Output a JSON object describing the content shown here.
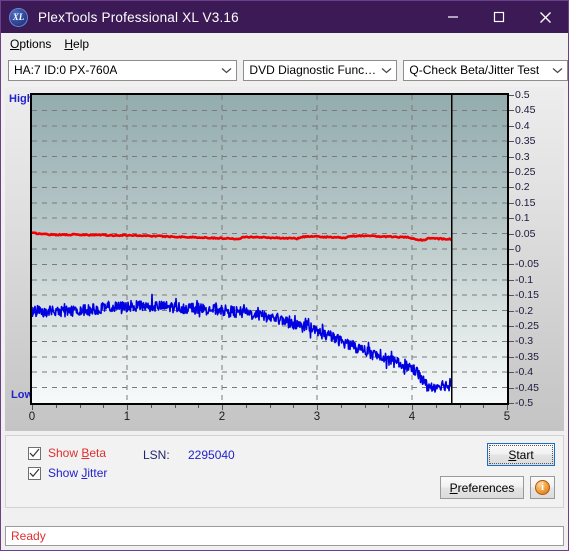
{
  "window": {
    "title": "PlexTools Professional XL V3.16",
    "logo_text": "XL",
    "minimize_icon": "minimize-icon",
    "maximize_icon": "maximize-icon",
    "close_icon": "close-icon"
  },
  "menubar": {
    "items": [
      {
        "label": "Options",
        "mnemonic": "O",
        "rest": "ptions"
      },
      {
        "label": "Help",
        "mnemonic": "H",
        "rest": "elp"
      }
    ]
  },
  "toolbar": {
    "drive_select": {
      "value": "HA:7 ID:0  PX-760A",
      "options": [
        "HA:7 ID:0  PX-760A"
      ]
    },
    "function_select": {
      "value": "DVD Diagnostic Functions",
      "options": [
        "DVD Diagnostic Functions"
      ]
    },
    "test_select": {
      "value": "Q-Check Beta/Jitter Test",
      "options": [
        "Q-Check Beta/Jitter Test"
      ]
    },
    "chevron_icon": "chevron-down-icon"
  },
  "chart_data": {
    "type": "line",
    "title": "Q-Check Beta/Jitter Test",
    "xlabel": "",
    "ylabel": "",
    "left_axis_top_label": "High",
    "left_axis_bottom_label": "Low",
    "xlim": [
      0,
      5
    ],
    "ylim": [
      -0.5,
      0.5
    ],
    "xticks": [
      0,
      1,
      2,
      3,
      4,
      5
    ],
    "xtick_labels": [
      "0",
      "1",
      "2",
      "3",
      "4",
      "5"
    ],
    "yticks": [
      0.5,
      0.45,
      0.4,
      0.35,
      0.3,
      0.25,
      0.2,
      0.15,
      0.1,
      0.05,
      0,
      -0.05,
      -0.1,
      -0.15,
      -0.2,
      -0.25,
      -0.3,
      -0.35,
      -0.4,
      -0.45,
      -0.5
    ],
    "ytick_labels": [
      "0.5",
      "0.45",
      "0.4",
      "0.35",
      "0.3",
      "0.25",
      "0.2",
      "0.15",
      "0.1",
      "0.05",
      "0",
      "-0.05",
      "-0.1",
      "-0.15",
      "-0.2",
      "-0.25",
      "-0.3",
      "-0.35",
      "-0.4",
      "-0.45",
      "-0.5"
    ],
    "grid": true,
    "grid_style": "dashed",
    "grid_color": "#7a7a7a",
    "data_end_x": 4.42,
    "end_marker": true,
    "series": [
      {
        "name": "Beta",
        "color": "#f00000",
        "x": [
          0.0,
          0.1,
          0.2,
          0.3,
          0.4,
          0.5,
          0.6,
          0.7,
          0.8,
          0.9,
          1.0,
          1.1,
          1.2,
          1.3,
          1.4,
          1.5,
          1.6,
          1.7,
          1.8,
          1.9,
          2.0,
          2.1,
          2.18,
          2.22,
          2.3,
          2.4,
          2.5,
          2.6,
          2.7,
          2.8,
          2.86,
          2.92,
          3.0,
          3.1,
          3.2,
          3.3,
          3.38,
          3.44,
          3.55,
          3.65,
          3.75,
          3.85,
          3.95,
          4.05,
          4.12,
          4.18,
          4.25,
          4.32,
          4.42
        ],
        "y": [
          0.052,
          0.049,
          0.047,
          0.046,
          0.047,
          0.046,
          0.045,
          0.046,
          0.045,
          0.044,
          0.045,
          0.044,
          0.043,
          0.042,
          0.041,
          0.04,
          0.039,
          0.038,
          0.037,
          0.036,
          0.035,
          0.034,
          0.033,
          0.04,
          0.039,
          0.038,
          0.037,
          0.036,
          0.035,
          0.034,
          0.04,
          0.041,
          0.04,
          0.039,
          0.038,
          0.037,
          0.042,
          0.043,
          0.042,
          0.041,
          0.04,
          0.039,
          0.038,
          0.03,
          0.029,
          0.035,
          0.034,
          0.033,
          0.032
        ]
      },
      {
        "name": "Jitter",
        "color": "#0000e0",
        "x": [
          0.0,
          0.1,
          0.2,
          0.3,
          0.4,
          0.5,
          0.6,
          0.7,
          0.8,
          0.9,
          1.0,
          1.1,
          1.2,
          1.3,
          1.4,
          1.5,
          1.6,
          1.7,
          1.8,
          1.9,
          2.0,
          2.1,
          2.2,
          2.3,
          2.4,
          2.5,
          2.6,
          2.7,
          2.8,
          2.9,
          3.0,
          3.1,
          3.2,
          3.3,
          3.4,
          3.5,
          3.6,
          3.7,
          3.8,
          3.9,
          4.0,
          4.05,
          4.1,
          4.15,
          4.2,
          4.25,
          4.3,
          4.35,
          4.42
        ],
        "y": [
          -0.2,
          -0.202,
          -0.203,
          -0.203,
          -0.202,
          -0.2,
          -0.197,
          -0.194,
          -0.191,
          -0.189,
          -0.187,
          -0.186,
          -0.185,
          -0.186,
          -0.187,
          -0.189,
          -0.191,
          -0.193,
          -0.195,
          -0.197,
          -0.199,
          -0.202,
          -0.206,
          -0.211,
          -0.216,
          -0.221,
          -0.228,
          -0.238,
          -0.248,
          -0.258,
          -0.268,
          -0.28,
          -0.292,
          -0.305,
          -0.318,
          -0.33,
          -0.343,
          -0.355,
          -0.366,
          -0.376,
          -0.386,
          -0.398,
          -0.42,
          -0.44,
          -0.452,
          -0.446,
          -0.44,
          -0.442,
          -0.444
        ],
        "noise_amplitude": 0.018
      }
    ]
  },
  "controls": {
    "show_beta": {
      "label": "Show Beta",
      "pre": "Show ",
      "mnemonic": "B",
      "rest": "eta",
      "checked": true
    },
    "show_jitter": {
      "label": "Show Jitter",
      "pre": "Show ",
      "mnemonic": "J",
      "rest": "itter",
      "checked": true
    },
    "lsn_label": "LSN:",
    "lsn_value": "2295040",
    "start_button": {
      "label": "Start",
      "mnemonic": "S",
      "pre": "",
      "rest": "tart",
      "focused": true
    },
    "preferences_button": {
      "label": "Preferences",
      "mnemonic": "P",
      "rest": "references"
    },
    "info_button": {
      "icon": "info-icon",
      "glyph": "i"
    }
  },
  "statusbar": {
    "text": "Ready"
  },
  "colors": {
    "titlebar": "#3b1a56",
    "beta": "#f00000",
    "jitter": "#0000e0",
    "accent_focus": "#1a6fc4",
    "status_text": "#e03030"
  }
}
